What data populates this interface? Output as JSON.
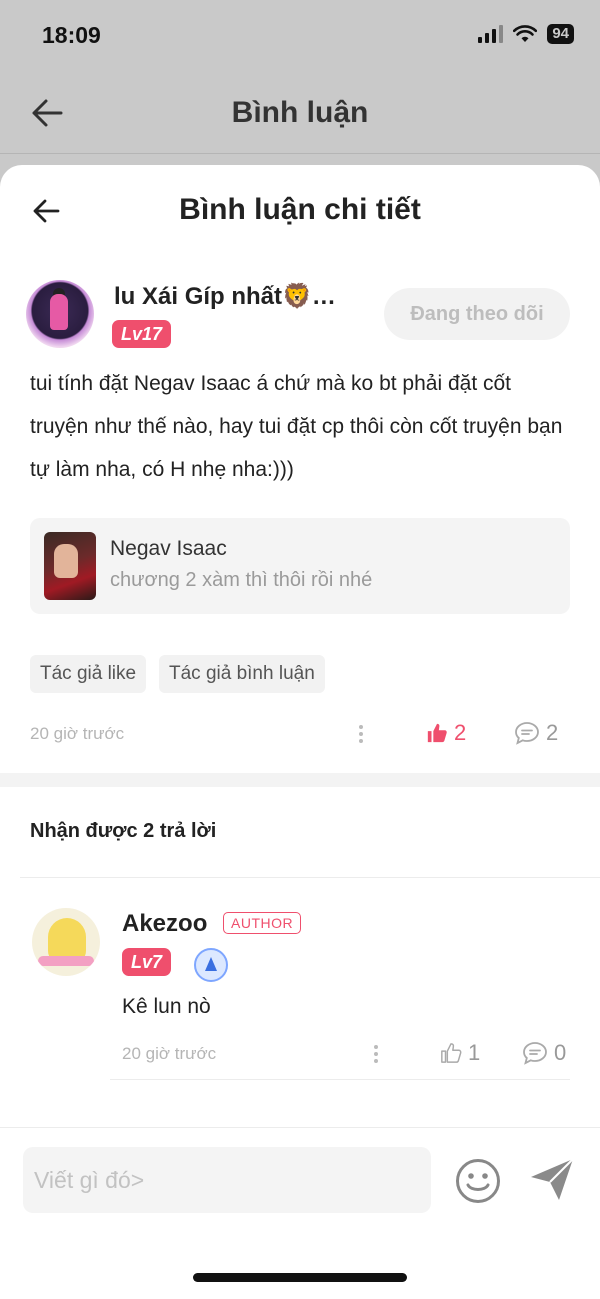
{
  "status_bar": {
    "time": "18:09",
    "battery": "94"
  },
  "background_page": {
    "title": "Bình luận"
  },
  "sheet": {
    "title": "Bình luận chi tiết"
  },
  "comment": {
    "author_name": "lu Xái Gíp nhất🦁…",
    "level": "Lv17",
    "follow_label": "Đang theo dõi",
    "text": "tui tính đặt Negav Isaac á chứ mà ko bt phải đặt cốt truyện như thế nào, hay tui đặt cp thôi còn cốt truyện bạn tự làm nha, có H nhẹ nha:)))",
    "story": {
      "title": "Negav Isaac",
      "subtitle": "chương 2 xàm thì thôi rồi nhé"
    },
    "tags": [
      "Tác giả like",
      "Tác giả bình luận"
    ],
    "time": "20 giờ trước",
    "likes": "2",
    "replies": "2",
    "like_color": "#ef4f6d"
  },
  "replies_section": {
    "title": "Nhận được 2 trả lời",
    "items": [
      {
        "name": "Akezoo",
        "badge": "AUTHOR",
        "level": "Lv7",
        "text": "Kê lun nò",
        "time": "20 giờ trước",
        "likes": "1",
        "replies": "0"
      }
    ]
  },
  "composer": {
    "placeholder": "Viết gì đó>"
  },
  "icons": [
    "back-arrow-icon",
    "signal-icon",
    "wifi-icon",
    "battery-icon",
    "more-dots-icon",
    "thumbs-up-icon",
    "comment-bubble-icon",
    "medal-icon",
    "emoji-icon",
    "send-icon"
  ],
  "colors": {
    "accent": "#ef4f6d",
    "muted": "#b5b5b5"
  }
}
